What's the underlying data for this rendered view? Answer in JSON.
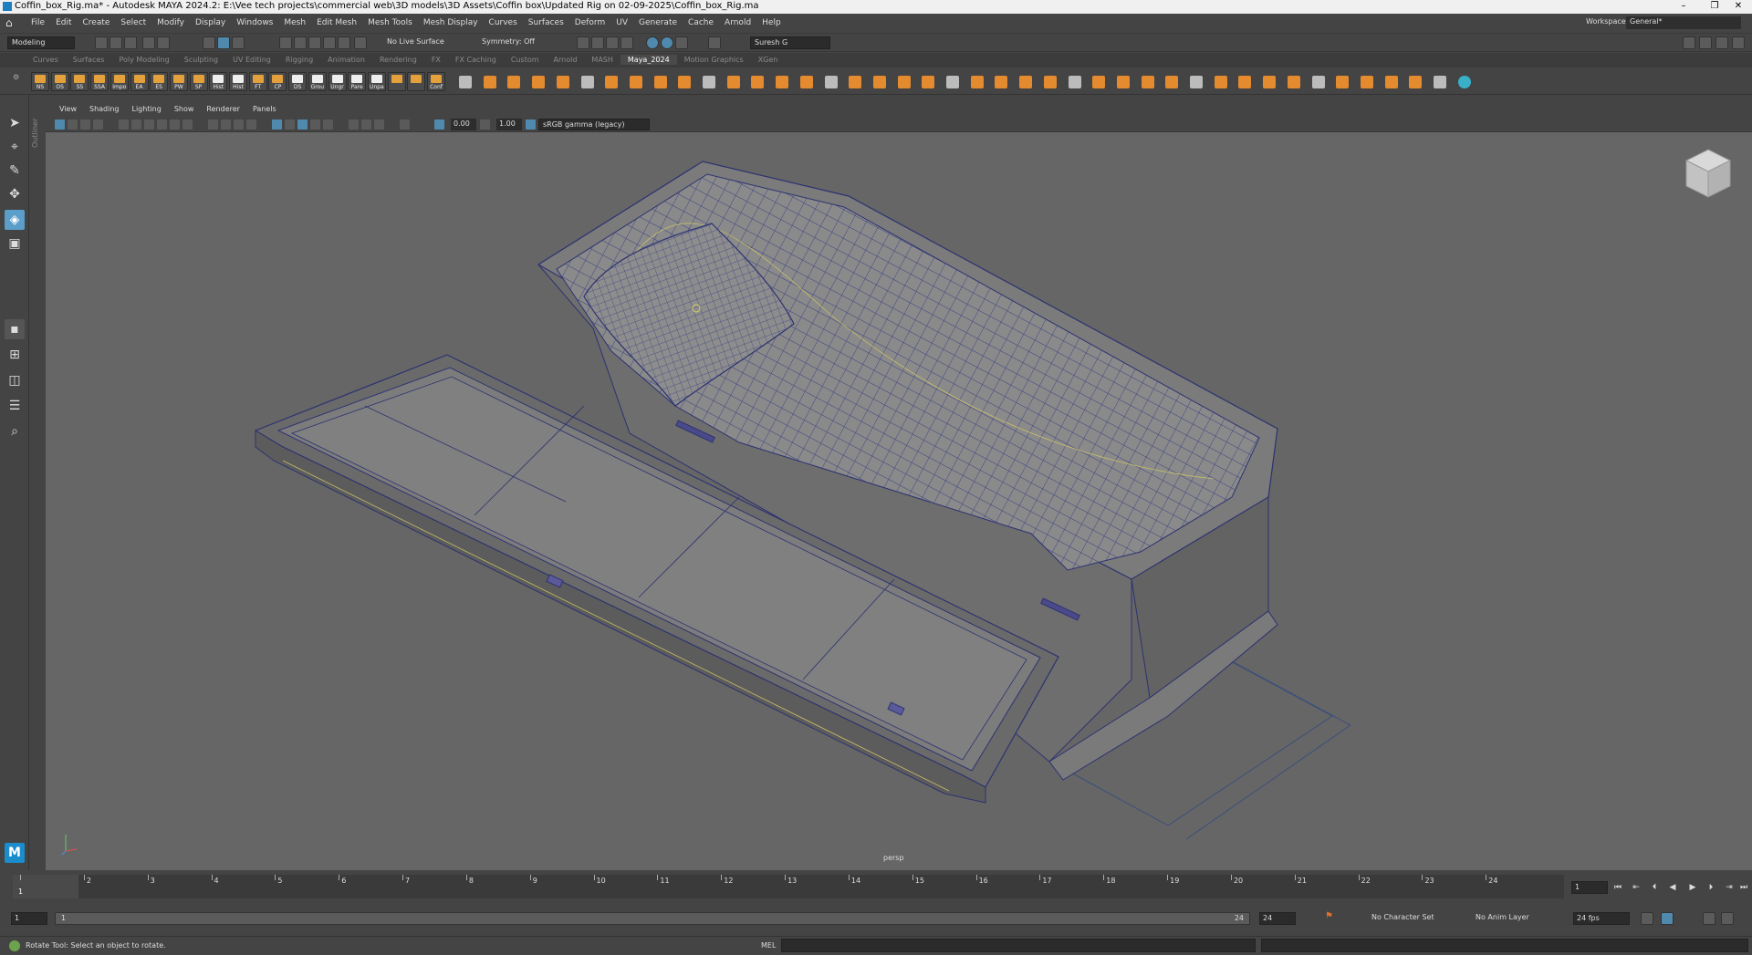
{
  "window": {
    "title": "Coffin_box_Rig.ma* - Autodesk MAYA 2024.2: E:\\Vee tech projects\\commercial web\\3D models\\3D Assets\\Coffin box\\Updated Rig on 02-09-2025\\Coffin_box_Rig.ma"
  },
  "menubar": {
    "items": [
      "File",
      "Edit",
      "Create",
      "Select",
      "Modify",
      "Display",
      "Windows",
      "Mesh",
      "Edit Mesh",
      "Mesh Tools",
      "Mesh Display",
      "Curves",
      "Surfaces",
      "Deform",
      "UV",
      "Generate",
      "Cache",
      "Arnold",
      "Help"
    ],
    "workspace_label": "Workspace:",
    "workspace_value": "General*"
  },
  "statusline": {
    "menuset": "Modeling",
    "live_surface": "No Live Surface",
    "symmetry": "Symmetry: Off",
    "user": "Suresh G"
  },
  "shelf_tabs": {
    "items": [
      "Curves",
      "Surfaces",
      "Poly Modeling",
      "Sculpting",
      "UV Editing",
      "Rigging",
      "Animation",
      "Rendering",
      "FX",
      "FX Caching",
      "Custom",
      "Arnold",
      "MASH",
      "Maya_2024",
      "Motion Graphics",
      "XGen"
    ],
    "active": "Maya_2024"
  },
  "shelf": {
    "labels": [
      "NS",
      "OS",
      "SS",
      "SSA",
      "Impo",
      "EA",
      "ES",
      "PW",
      "SP",
      "Hist",
      "Hist",
      "FT",
      "CP",
      "DS",
      "Grou",
      "Ungr",
      "Pare",
      "Unpa",
      "",
      "",
      "Conf"
    ]
  },
  "viewport": {
    "menu": [
      "View",
      "Shading",
      "Lighting",
      "Show",
      "Renderer",
      "Panels"
    ],
    "exposure": "0.00",
    "gamma": "1.00",
    "color_space": "sRGB gamma (legacy)",
    "camera": "persp",
    "outliner_tab": "Outliner"
  },
  "timeslider": {
    "ticks": [
      "1",
      "2",
      "3",
      "4",
      "5",
      "6",
      "7",
      "8",
      "9",
      "10",
      "11",
      "12",
      "13",
      "14",
      "15",
      "16",
      "17",
      "18",
      "19",
      "20",
      "21",
      "22",
      "23",
      "24"
    ],
    "current_frame": "1",
    "current_marker": "1"
  },
  "rangeslider": {
    "start": "1",
    "range_start": "1",
    "range_end": "24",
    "end": "24",
    "character_set": "No Character Set",
    "anim_layer": "No Anim Layer",
    "fps": "24 fps"
  },
  "commandline": {
    "help": "Rotate Tool: Select an object to rotate.",
    "language": "MEL"
  }
}
